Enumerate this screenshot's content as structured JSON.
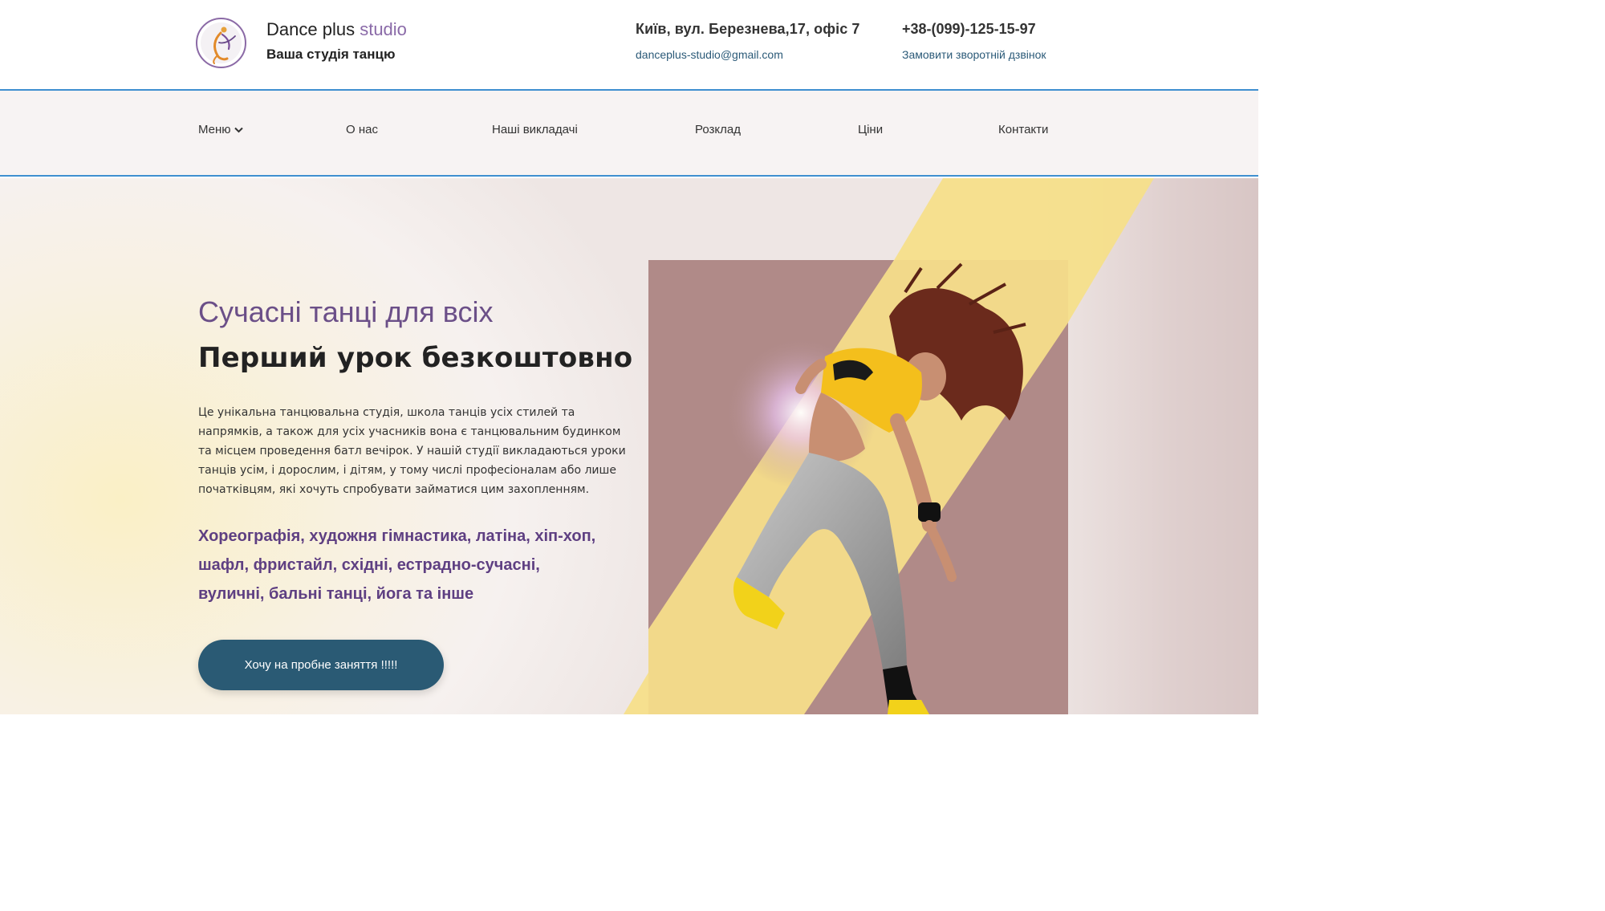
{
  "header": {
    "brand_main": "Dance plus",
    "brand_accent": "studio",
    "tagline": "Ваша студія танцю",
    "address": "Київ, вул. Березнева,17, офіс 7",
    "email": "danceplus-studio@gmail.com",
    "phone": "+38-(099)-125-15-97",
    "callback_label": "Замовити зворотній дзвінок"
  },
  "nav": {
    "items": [
      "Меню",
      "О нас",
      "Наші викладачі",
      "Розклад",
      "Ціни",
      "Контакти"
    ]
  },
  "hero": {
    "subtitle": "Сучасні танці для всіх",
    "title": "Перший урок безкоштовно",
    "description": "Це унікальна танцювальна студія, школа танців усіх стилей та напрямків, а також для усіх учасників вона є танцювальним будинком та місцем проведення батл вечірок. У нашій студії викладаються уроки танців усім, і дорослим, і дітям, у тому числі професіоналам або лише початківцям, які хочуть спробувати займатися цим захопленням.",
    "styles": "Хореографія, художня гімнастика, латіна, хіп-хоп, шафл, фристайл, східні, естрадно-сучасні, вуличні, бальні танці, йога та інше",
    "cta_label": "Хочу на пробне заняття !!!!!"
  },
  "icons": {
    "logo": "dancer-logo-icon",
    "menu_dropdown": "chevron-down-icon"
  },
  "colors": {
    "accent_purple": "#8a6aa8",
    "link_blue": "#2b5a78",
    "cta_bg": "#2a5a74",
    "nav_border": "#3f8fd0",
    "stripe_yellow": "#f5df8a",
    "photo_bg": "#b08a88"
  }
}
